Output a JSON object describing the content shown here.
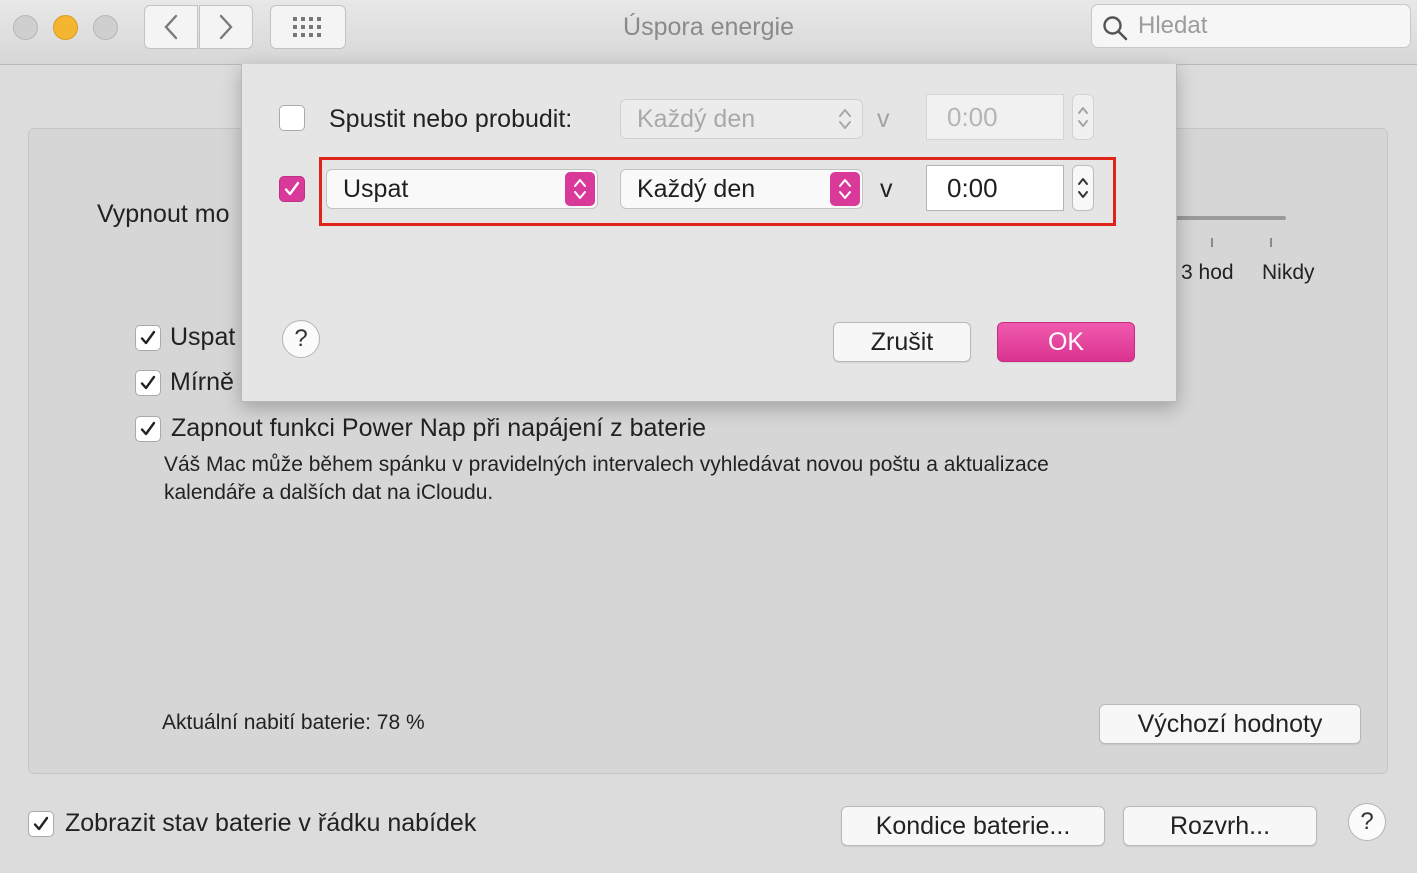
{
  "window": {
    "title": "Úspora energie",
    "search_placeholder": "Hledat"
  },
  "main": {
    "turn_off_display_label": "Vypnout mo",
    "slider_ticks": [
      "3 hod",
      "Nikdy"
    ],
    "options": [
      {
        "label": "Uspat",
        "checked": true
      },
      {
        "label": "Mírně",
        "checked": true
      },
      {
        "label": "Zapnout funkci Power Nap při napájení z baterie",
        "checked": true
      }
    ],
    "power_nap_desc_line1": "Váš Mac může během spánku v pravidelných intervalech vyhledávat novou poštu a aktualizace",
    "power_nap_desc_line2": "kalendáře a dalších dat na iCloudu.",
    "battery_level": "Aktuální nabití baterie: 78 %",
    "defaults_button": "Výchozí hodnoty"
  },
  "footer": {
    "show_status_label": "Zobrazit stav baterie v řádku nabídek",
    "show_status_checked": true,
    "battery_health_button": "Kondice baterie...",
    "schedule_button": "Rozvrh..."
  },
  "dialog": {
    "row1": {
      "checked": false,
      "label": "Spustit nebo probudit:",
      "frequency": "Každý den",
      "at_label": "v",
      "time": "0:00"
    },
    "row2": {
      "checked": true,
      "action": "Uspat",
      "frequency": "Každý den",
      "at_label": "v",
      "time": "0:00"
    },
    "cancel_button": "Zrušit",
    "ok_button": "OK",
    "help_label": "?"
  },
  "colors": {
    "accent": "#da3391",
    "highlight": "#e0241b",
    "traffic_minimize": "#f4b630"
  }
}
